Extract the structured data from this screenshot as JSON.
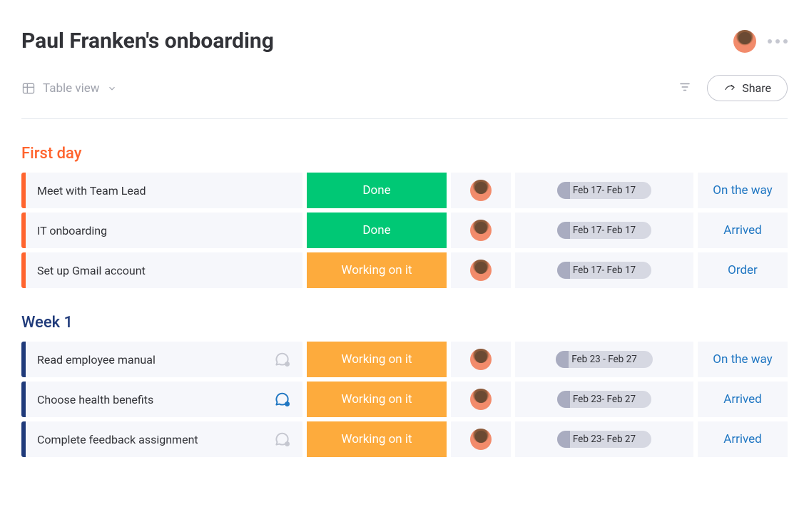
{
  "header": {
    "title": "Paul Franken's onboarding"
  },
  "toolbar": {
    "view_label": "Table view",
    "share_label": "Share"
  },
  "groups": [
    {
      "id": "first-day",
      "title": "First day",
      "color": "orange",
      "rows": [
        {
          "task": "Meet with Team Lead",
          "chat": "none",
          "status": "Done",
          "status_kind": "done",
          "date": "Feb 17- Feb 17",
          "action": "On the way"
        },
        {
          "task": "IT onboarding",
          "chat": "none",
          "status": "Done",
          "status_kind": "done",
          "date": "Feb 17- Feb 17",
          "action": "Arrived"
        },
        {
          "task": "Set up Gmail account",
          "chat": "none",
          "status": "Working on it",
          "status_kind": "working",
          "date": "Feb 17- Feb 17",
          "action": "Order"
        }
      ]
    },
    {
      "id": "week-1",
      "title": "Week 1",
      "color": "navy",
      "rows": [
        {
          "task": "Read employee manual",
          "chat": "muted",
          "status": "Working on it",
          "status_kind": "working",
          "date": "Feb 23 - Feb 27",
          "action": "On the way"
        },
        {
          "task": "Choose health benefits",
          "chat": "active",
          "status": "Working on it",
          "status_kind": "working",
          "date": "Feb 23- Feb 27",
          "action": "Arrived"
        },
        {
          "task": "Complete feedback assignment",
          "chat": "muted",
          "status": "Working on it",
          "status_kind": "working",
          "date": "Feb 23- Feb 27",
          "action": "Arrived"
        }
      ]
    }
  ]
}
